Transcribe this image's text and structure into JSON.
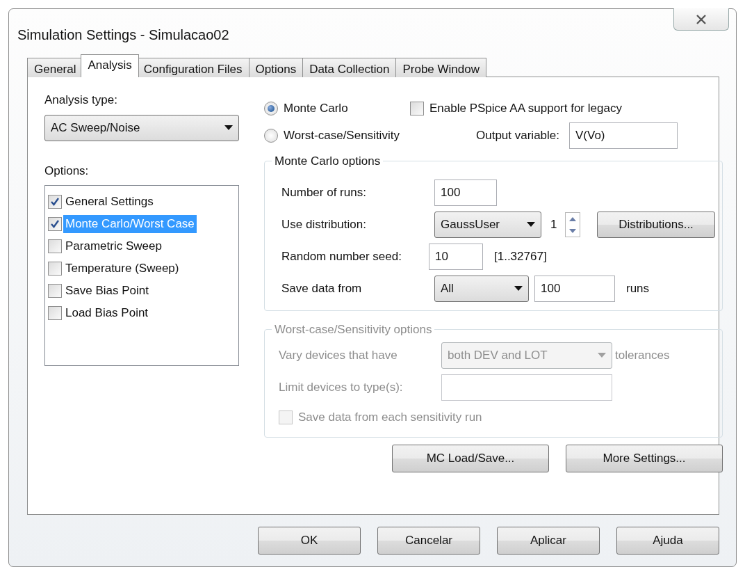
{
  "window": {
    "title": "Simulation Settings - Simulacao02"
  },
  "tabs": [
    {
      "label": "General",
      "selected": false
    },
    {
      "label": "Analysis",
      "selected": true
    },
    {
      "label": "Configuration Files",
      "selected": false
    },
    {
      "label": "Options",
      "selected": false
    },
    {
      "label": "Data Collection",
      "selected": false
    },
    {
      "label": "Probe Window",
      "selected": false
    }
  ],
  "analysis_type": {
    "label": "Analysis type:",
    "value": "AC Sweep/Noise"
  },
  "options": {
    "label": "Options:",
    "items": [
      {
        "label": "General Settings",
        "checked": true,
        "selected": false
      },
      {
        "label": "Monte Carlo/Worst Case",
        "checked": true,
        "selected": true
      },
      {
        "label": "Parametric Sweep",
        "checked": false,
        "selected": false
      },
      {
        "label": "Temperature (Sweep)",
        "checked": false,
        "selected": false
      },
      {
        "label": "Save Bias Point",
        "checked": false,
        "selected": false
      },
      {
        "label": "Load Bias Point",
        "checked": false,
        "selected": false
      }
    ]
  },
  "modes": [
    {
      "label": "Monte Carlo",
      "selected": true
    },
    {
      "label": "Worst-case/Sensitivity",
      "selected": false
    }
  ],
  "legacy": {
    "label": "Enable PSpice AA support for legacy",
    "checked": false
  },
  "output_variable": {
    "label": "Output variable:",
    "value": "V(Vo)"
  },
  "monte_carlo": {
    "title": "Monte Carlo options",
    "runs": {
      "label": "Number of runs:",
      "value": "100"
    },
    "distribution": {
      "label": "Use distribution:",
      "value": "GaussUser",
      "spin_value": "1",
      "button": "Distributions..."
    },
    "seed": {
      "label": "Random number seed:",
      "value": "10",
      "range": "[1..32767]"
    },
    "save_data": {
      "label": "Save data from",
      "value": "All",
      "count": "100",
      "unit": "runs"
    }
  },
  "worst_case": {
    "title": "Worst-case/Sensitivity options",
    "disabled": true,
    "vary": {
      "label": "Vary devices that have",
      "value": "both DEV and LOT",
      "suffix": "tolerances"
    },
    "limit": {
      "label": "Limit devices to type(s):"
    },
    "save_each": {
      "label": "Save data from each sensitivity run",
      "checked": false
    }
  },
  "panel_buttons": [
    "MC Load/Save...",
    "More Settings..."
  ],
  "dialog_buttons": [
    "OK",
    "Cancelar",
    "Aplicar",
    "Ajuda"
  ]
}
